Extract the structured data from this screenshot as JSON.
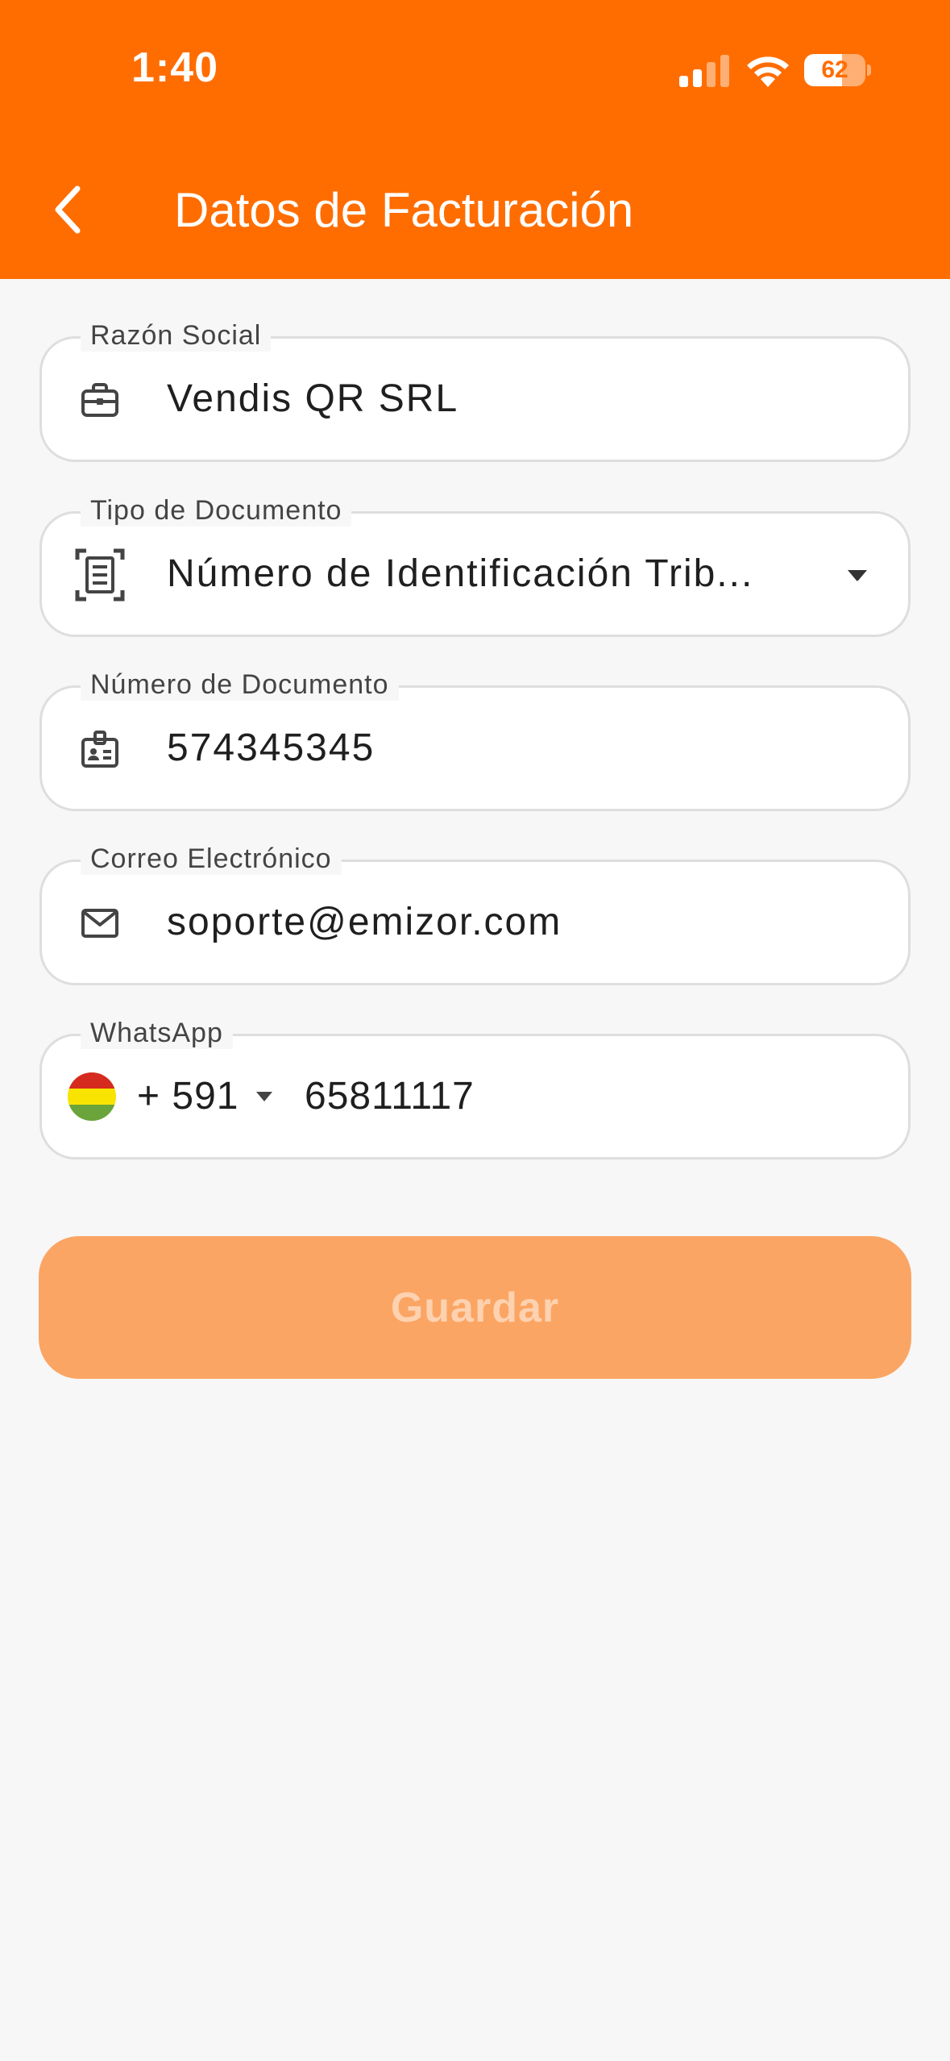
{
  "status_bar": {
    "time": "1:40",
    "battery": "62",
    "battery_level": 0.62
  },
  "header": {
    "title": "Datos de Facturación",
    "back_icon": "chevron-left-icon"
  },
  "form": {
    "razon_social": {
      "label": "Razón Social",
      "value": "Vendis QR SRL",
      "icon": "briefcase-icon"
    },
    "tipo_documento": {
      "label": "Tipo de Documento",
      "value": "Número de Identificación Trib...",
      "icon": "document-scan-icon"
    },
    "numero_documento": {
      "label": "Número de Documento",
      "value": "574345345",
      "icon": "id-badge-icon"
    },
    "correo": {
      "label": "Correo Electrónico",
      "value": "soporte@emizor.com",
      "icon": "mail-icon"
    },
    "whatsapp": {
      "label": "WhatsApp",
      "dial_code": "+ 591",
      "value": "65811117",
      "flag": "bolivia-flag-icon"
    }
  },
  "actions": {
    "save_label": "Guardar"
  },
  "colors": {
    "primary": "#ff6d00",
    "button_disabled": "#fba564",
    "background": "#f7f7f7"
  }
}
